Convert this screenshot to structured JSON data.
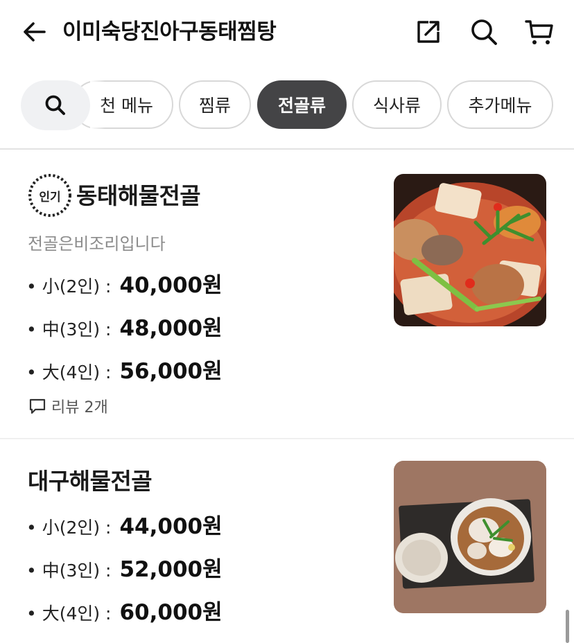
{
  "header": {
    "title": "이미숙당진아구동태찜탕",
    "back_icon": "arrow-left-icon",
    "share_icon": "share-external-icon",
    "search_icon": "search-icon",
    "cart_icon": "cart-icon"
  },
  "category_tabs": {
    "search_icon": "search-icon",
    "items": [
      {
        "label": "천 메뉴",
        "active": false
      },
      {
        "label": "찜류",
        "active": false
      },
      {
        "label": "전골류",
        "active": true
      },
      {
        "label": "식사류",
        "active": false
      },
      {
        "label": "추가메뉴",
        "active": false
      }
    ]
  },
  "menu_items": [
    {
      "badge": "인기",
      "name": "동태해물전골",
      "description": "전골은비조리입니다",
      "prices": [
        {
          "label": "• 小(2인) :",
          "value": "40,000원"
        },
        {
          "label": "• 中(3인) :",
          "value": "48,000원"
        },
        {
          "label": "• 大(4인) :",
          "value": "56,000원"
        }
      ],
      "review": "리뷰 2개",
      "image": "stew-photo"
    },
    {
      "name": "대구해물전골",
      "prices": [
        {
          "label": "• 小(2인) :",
          "value": "44,000원"
        },
        {
          "label": "• 中(3인) :",
          "value": "52,000원"
        },
        {
          "label": "• 大(4인) :",
          "value": "60,000원"
        }
      ],
      "image": "hotpot-photo"
    }
  ],
  "colors": {
    "active_chip": "#444446",
    "chip_border": "#d8d8d8",
    "muted_text": "#8b8b8b"
  }
}
